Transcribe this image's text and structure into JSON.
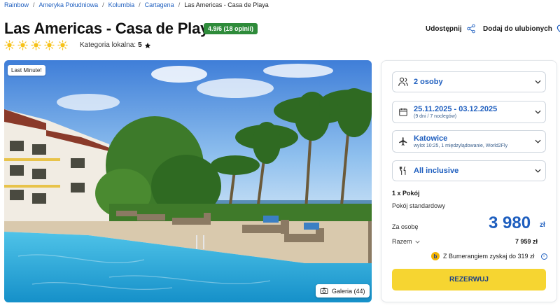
{
  "breadcrumb": {
    "items": [
      "Rainbow",
      "Ameryka Południowa",
      "Kolumbia",
      "Cartagena"
    ],
    "current": "Las Americas - Casa de Playa"
  },
  "hotel": {
    "name": "Las Americas - Casa de Playa",
    "rating": "4.9/6 (18 opinii)",
    "stars": 5,
    "category_label": "Kategoria lokalna:",
    "category_value": "5"
  },
  "actions": {
    "share": "Udostępnij",
    "favorite": "Dodaj do ulubionych"
  },
  "photo": {
    "badge": "Last Minute!",
    "gallery_label": "Galeria (44)"
  },
  "booking": {
    "people": "2 osoby",
    "dates": "25.11.2025 - 03.12.2025",
    "dates_sub": "(9 dni / 7 noclegów)",
    "departure": "Katowice",
    "departure_sub": "wylot 10:25, 1 międzylądowanie, World2Fly",
    "board": "All inclusive",
    "room_count": "1 x Pokój",
    "room_type": "Pokój standardowy",
    "per_person_label": "Za osobę",
    "price": "3 980",
    "currency": "zł",
    "total_label": "Razem",
    "total_value": "7 959 zł",
    "bumerang_text": "Z Bumerangiem zyskaj do 319 zł",
    "reserve_button": "REZERWUJ"
  },
  "colors": {
    "accent": "#1f5fbf",
    "rating_green": "#2e8b3a",
    "button_yellow": "#f6d531",
    "sun_yellow": "#f6c21a"
  }
}
